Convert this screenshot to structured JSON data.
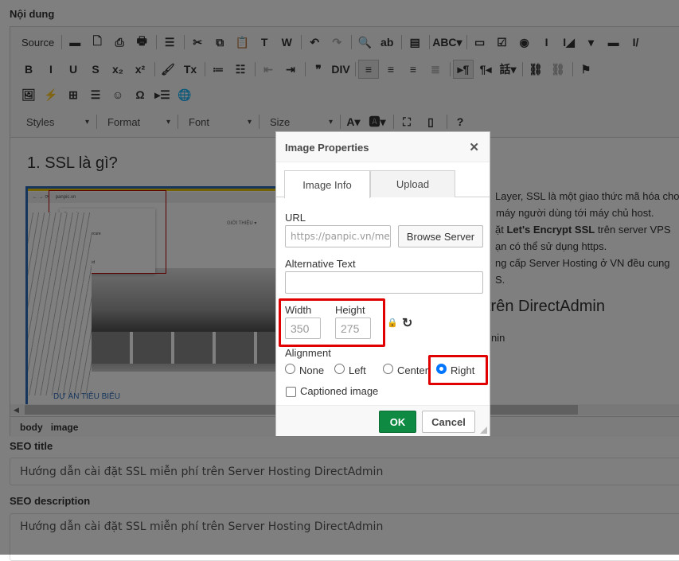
{
  "content_label": "Nội dung",
  "toolbar": {
    "row1": [
      {
        "t": "Source",
        "n": "source-button"
      },
      {
        "t": "▬",
        "n": "save-icon"
      },
      {
        "t": "🗋",
        "n": "new-page-icon"
      },
      {
        "t": "⎙",
        "n": "preview-icon"
      },
      {
        "t": "🖶",
        "n": "print-icon"
      },
      {
        "t": "☰",
        "n": "templates-icon"
      },
      {
        "t": "✂",
        "n": "cut-icon"
      },
      {
        "t": "⧉",
        "n": "copy-icon"
      },
      {
        "t": "📋",
        "n": "paste-icon"
      },
      {
        "t": "T",
        "n": "paste-text-icon"
      },
      {
        "t": "W",
        "n": "paste-word-icon"
      },
      {
        "t": "↶",
        "n": "undo-icon"
      },
      {
        "t": "↷",
        "n": "redo-icon"
      },
      {
        "t": "🔍",
        "n": "find-icon"
      },
      {
        "t": "ab",
        "n": "replace-icon"
      },
      {
        "t": "▤",
        "n": "select-all-icon"
      },
      {
        "t": "ABC▾",
        "n": "spellcheck-icon"
      },
      {
        "t": "▭",
        "n": "form-icon"
      },
      {
        "t": "☑",
        "n": "checkbox-icon"
      },
      {
        "t": "◉",
        "n": "radio-icon"
      },
      {
        "t": "I",
        "n": "textfield-icon"
      },
      {
        "t": "I◢",
        "n": "textarea-icon"
      },
      {
        "t": "▾",
        "n": "select-icon"
      },
      {
        "t": "▬",
        "n": "button-icon"
      },
      {
        "t": "I/",
        "n": "hidden-field-icon"
      }
    ],
    "row2": [
      {
        "t": "B",
        "n": "bold-icon"
      },
      {
        "t": "I",
        "n": "italic-icon"
      },
      {
        "t": "U",
        "n": "underline-icon"
      },
      {
        "t": "S",
        "n": "strike-icon"
      },
      {
        "t": "x₂",
        "n": "subscript-icon"
      },
      {
        "t": "x²",
        "n": "superscript-icon"
      },
      {
        "t": "🖌",
        "n": "copy-format-icon"
      },
      {
        "t": "Tx",
        "n": "remove-format-icon"
      },
      {
        "t": "≔",
        "n": "numbered-list-icon"
      },
      {
        "t": "☷",
        "n": "bulleted-list-icon"
      },
      {
        "t": "⇤",
        "n": "outdent-icon"
      },
      {
        "t": "⇥",
        "n": "indent-icon"
      },
      {
        "t": "❞",
        "n": "blockquote-icon"
      },
      {
        "t": "DIV",
        "n": "div-icon"
      },
      {
        "t": "≡",
        "n": "align-left-icon"
      },
      {
        "t": "≡",
        "n": "align-center-icon"
      },
      {
        "t": "≡",
        "n": "align-right-icon"
      },
      {
        "t": "≣",
        "n": "justify-icon"
      },
      {
        "t": "▸¶",
        "n": "ltr-icon"
      },
      {
        "t": "¶◂",
        "n": "rtl-icon"
      },
      {
        "t": "話▾",
        "n": "language-icon"
      },
      {
        "t": "⛓",
        "n": "link-icon"
      },
      {
        "t": "⛓",
        "n": "unlink-icon"
      },
      {
        "t": "⚑",
        "n": "anchor-icon"
      }
    ],
    "row3": [
      {
        "t": "🖼",
        "n": "image-icon"
      },
      {
        "t": "⚡",
        "n": "flash-icon"
      },
      {
        "t": "⊞",
        "n": "table-icon"
      },
      {
        "t": "☰",
        "n": "horizontal-line-icon"
      },
      {
        "t": "☺",
        "n": "smiley-icon"
      },
      {
        "t": "Ω",
        "n": "special-char-icon"
      },
      {
        "t": "▸☰",
        "n": "page-break-icon"
      },
      {
        "t": "🌐",
        "n": "iframe-icon"
      }
    ],
    "combos": [
      "Styles",
      "Format",
      "Font",
      "Size"
    ],
    "row4": [
      {
        "t": "A▾",
        "n": "text-color-icon"
      },
      {
        "t": "🅰▾",
        "n": "bg-color-icon"
      },
      {
        "t": "⛶",
        "n": "maximize-icon"
      },
      {
        "t": "▯",
        "n": "show-blocks-icon"
      },
      {
        "t": "?",
        "n": "about-icon"
      }
    ]
  },
  "editor": {
    "heading": "1. SSL là gì?",
    "lines": [
      "Layer, SSL là một giao thức mã hóa cho",
      "máy người dùng  tới máy chủ host.",
      "ặt ",
      "Let's Encrypt SSL",
      " trên server VPS",
      "ạn có thể sử dụng https.",
      "ng cấp Server Hosting ở VN đều cung",
      "S."
    ],
    "heading2": "trên DirectAdmin",
    "line_after": "nin",
    "image_texts": {
      "url": "panpic.vn",
      "security": "Security",
      "secure": "Connection is secure",
      "cert": "Certificate is valid",
      "nav": "GIỚI THIỆU ▾",
      "projects": "DỰ ÁN TIÊU BIỂU"
    },
    "path": [
      "body",
      "image"
    ]
  },
  "seo": {
    "title_label": "SEO title",
    "title_value": "Hướng dẫn cài đặt SSL miễn phí trên Server Hosting DirectAdmin",
    "desc_label": "SEO description",
    "desc_value": "Hướng dẫn cài đặt SSL miễn phí trên Server Hosting DirectAdmin"
  },
  "dialog": {
    "title": "Image Properties",
    "close": "✕",
    "tabs": [
      "Image Info",
      "Upload"
    ],
    "url_label": "URL",
    "url_value": "https://panpic.vn/media",
    "browse": "Browse Server",
    "alt_label": "Alternative Text",
    "alt_value": "",
    "width_label": "Width",
    "width_value": "350",
    "height_label": "Height",
    "height_value": "275",
    "lock": "🔒",
    "reset": "↻",
    "alignment_label": "Alignment",
    "alignments": [
      "None",
      "Left",
      "Center",
      "Right"
    ],
    "selected_alignment": "Right",
    "captioned": "Captioned image",
    "captioned_checked": false,
    "ok": "OK",
    "cancel": "Cancel",
    "colors": {
      "ok": "#0f8a43",
      "highlight": "#e00000",
      "radio": "#0075ff"
    }
  }
}
